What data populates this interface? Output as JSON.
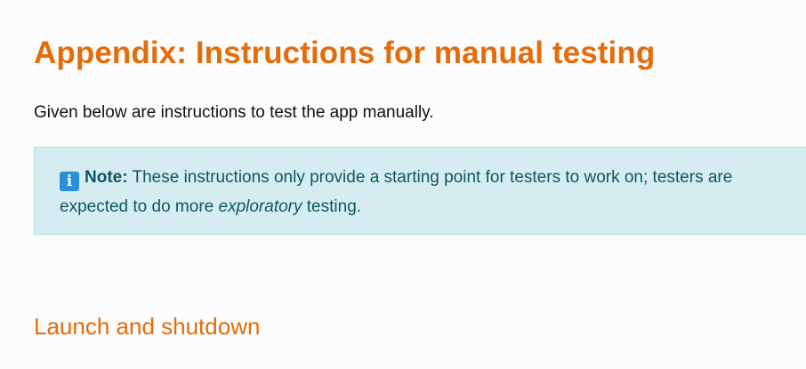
{
  "heading": "Appendix: Instructions for manual testing",
  "intro": "Given below are instructions to test the app manually.",
  "note": {
    "icon": "info-icon",
    "icon_glyph": "i",
    "label": "Note:",
    "line1": "These instructions only provide a starting point for testers to work on; testers are",
    "line2_pre": "expected to do more ",
    "line2_em": "exploratory",
    "line2_post": " testing."
  },
  "section_heading": "Launch and shutdown",
  "colors": {
    "heading": "#e46c0a",
    "note_background": "#d5edf1",
    "note_text": "#0f5565",
    "info_icon": "#2a8fd6"
  }
}
